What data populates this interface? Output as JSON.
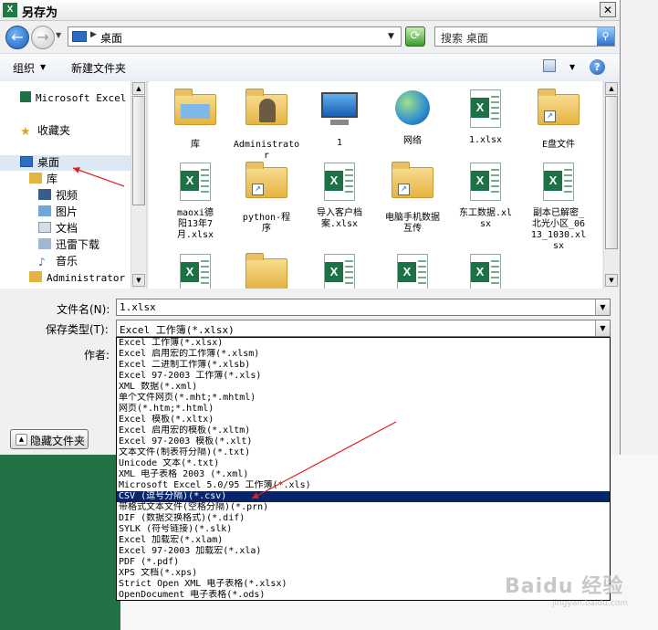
{
  "window": {
    "title": "另存为",
    "close_label": "✕"
  },
  "address": {
    "location": "桌面",
    "search_placeholder": "搜索 桌面"
  },
  "toolbar": {
    "organize": "组织",
    "new_folder": "新建文件夹"
  },
  "nav": {
    "items": [
      {
        "label": "Microsoft Excel",
        "icon": "excel-icon"
      },
      {
        "label": "收藏夹",
        "icon": "star-icon"
      },
      {
        "label": "桌面",
        "icon": "desktop-icon",
        "selected": true
      },
      {
        "label": "库",
        "icon": "library-icon"
      },
      {
        "label": "视频",
        "icon": "video-icon"
      },
      {
        "label": "图片",
        "icon": "picture-icon"
      },
      {
        "label": "文档",
        "icon": "document-icon"
      },
      {
        "label": "迅雷下载",
        "icon": "download-icon"
      },
      {
        "label": "音乐",
        "icon": "music-icon"
      },
      {
        "label": "Administrator",
        "icon": "user-icon"
      }
    ]
  },
  "files": {
    "row1": [
      {
        "label": "库",
        "icon": "library-folder-icon"
      },
      {
        "label": "Administrator",
        "icon": "user-folder-icon"
      },
      {
        "label": "1",
        "icon": "computer-icon"
      },
      {
        "label": "网络",
        "icon": "network-icon"
      },
      {
        "label": "1.xlsx",
        "icon": "excel-file-icon"
      },
      {
        "label": "E盘文件",
        "icon": "folder-shortcut-icon"
      }
    ],
    "row2": [
      {
        "label": "maoxi德阳13年7月.xlsx",
        "icon": "excel-file-icon"
      },
      {
        "label": "python-程序",
        "icon": "folder-shortcut-icon"
      },
      {
        "label": "导入客户档案.xlsx",
        "icon": "excel-file-icon"
      },
      {
        "label": "电脑手机数据互传",
        "icon": "folder-shortcut-icon"
      },
      {
        "label": "东工数据.xlsx",
        "icon": "excel-file-icon"
      },
      {
        "label": "副本已解密_北光小区_0613_1030.xlsx",
        "icon": "excel-file-icon"
      }
    ]
  },
  "form": {
    "filename_label": "文件名(N):",
    "filename_value": "1.xlsx",
    "filetype_label": "保存类型(T):",
    "filetype_value": "Excel 工作簿(*.xlsx)",
    "author_label": "作者:",
    "hide_folders": "隐藏文件夹"
  },
  "file_types": [
    "Excel 工作簿(*.xlsx)",
    "Excel 启用宏的工作簿(*.xlsm)",
    "Excel 二进制工作簿(*.xlsb)",
    "Excel 97-2003 工作簿(*.xls)",
    "XML 数据(*.xml)",
    "单个文件网页(*.mht;*.mhtml)",
    "网页(*.htm;*.html)",
    "Excel 模板(*.xltx)",
    "Excel 启用宏的模板(*.xltm)",
    "Excel 97-2003 模板(*.xlt)",
    "文本文件(制表符分隔)(*.txt)",
    "Unicode 文本(*.txt)",
    "XML 电子表格 2003 (*.xml)",
    "Microsoft Excel 5.0/95 工作簿(*.xls)",
    "CSV (逗号分隔)(*.csv)",
    "带格式文本文件(空格分隔)(*.prn)",
    "DIF (数据交换格式)(*.dif)",
    "SYLK (符号链接)(*.slk)",
    "Excel 加载宏(*.xlam)",
    "Excel 97-2003 加载宏(*.xla)",
    "PDF (*.pdf)",
    "XPS 文档(*.xps)",
    "Strict Open XML 电子表格(*.xlsx)",
    "OpenDocument 电子表格(*.ods)"
  ],
  "selected_file_type_index": 14,
  "watermark": {
    "brand": "Baidu 经验",
    "url": "jingyan.baidu.com"
  },
  "colors": {
    "excel_green": "#217346",
    "selection": "#0a246a",
    "arrow": "#e02020"
  }
}
